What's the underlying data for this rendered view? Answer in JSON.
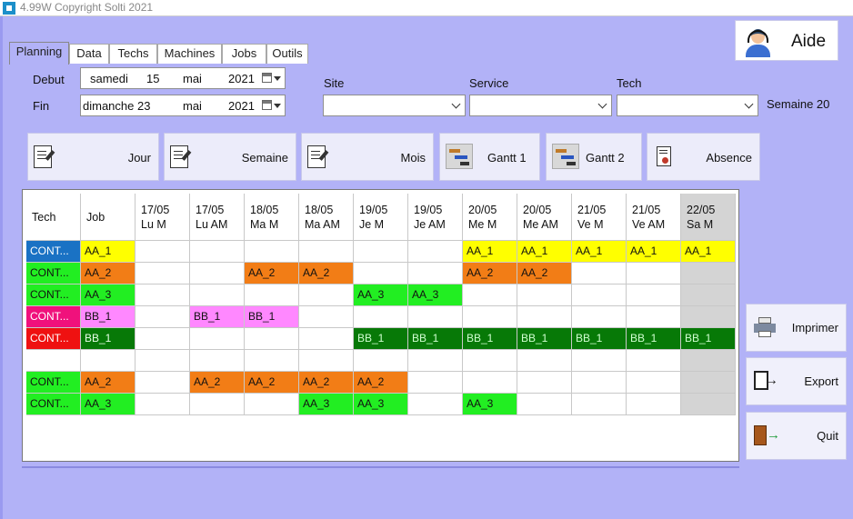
{
  "window": {
    "title": "4.99W Copyright Solti 2021"
  },
  "tabs": [
    "Planning",
    "Data",
    "Techs",
    "Machines",
    "Jobs",
    "Outils"
  ],
  "form": {
    "debut_label": "Debut",
    "fin_label": "Fin",
    "debut": {
      "weekday": "samedi",
      "day": "15",
      "month": "mai",
      "year": "2021"
    },
    "fin": {
      "weekday_day": "dimanche 23",
      "month": "mai",
      "year": "2021"
    },
    "site_label": "Site",
    "service_label": "Service",
    "tech_label": "Tech",
    "semaine": "Semaine 20"
  },
  "toolbar": {
    "jour": "Jour",
    "semaine": "Semaine",
    "mois": "Mois",
    "gantt1": "Gantt 1",
    "gantt2": "Gantt 2",
    "absence": "Absence"
  },
  "aide": "Aide",
  "side": {
    "imprimer": "Imprimer",
    "export": "Export",
    "quit": "Quit"
  },
  "colors": {
    "background": "#b2b2f7",
    "yellow": "#ffff00",
    "orange": "#f27d16",
    "green": "#22ee22",
    "pink": "#ff88ff",
    "darkgreen": "#077907",
    "blue": "#1a72c4",
    "magenta": "#f0117c",
    "red": "#ef1111",
    "weekend": "#d4d4d4"
  },
  "grid": {
    "header_tech": "Tech",
    "header_job": "Job",
    "columns": [
      {
        "date": "17/05",
        "slot": "Lu M"
      },
      {
        "date": "17/05",
        "slot": "Lu AM"
      },
      {
        "date": "18/05",
        "slot": "Ma M"
      },
      {
        "date": "18/05",
        "slot": "Ma AM"
      },
      {
        "date": "19/05",
        "slot": "Je M"
      },
      {
        "date": "19/05",
        "slot": "Je AM"
      },
      {
        "date": "20/05",
        "slot": "Me M"
      },
      {
        "date": "20/05",
        "slot": "Me AM"
      },
      {
        "date": "21/05",
        "slot": "Ve M"
      },
      {
        "date": "21/05",
        "slot": "Ve AM"
      },
      {
        "date": "22/05",
        "slot": "Sa M"
      }
    ],
    "rows": [
      {
        "tech": "CONT...",
        "tech_color": "blue",
        "job": "AA_1",
        "job_color": "yellow",
        "cells": [
          "",
          "",
          "",
          "",
          "",
          "",
          "AA_1",
          "AA_1",
          "AA_1",
          "AA_1",
          "AA_1"
        ],
        "cell_color": "yellow",
        "filled": [
          6,
          7,
          8,
          9,
          10
        ]
      },
      {
        "tech": "CONT...",
        "tech_color": "green",
        "job": "AA_2",
        "job_color": "orange",
        "cells": [
          "",
          "",
          "AA_2",
          "AA_2",
          "",
          "",
          "AA_2",
          "AA_2",
          "",
          "",
          ""
        ],
        "cell_color": "orange",
        "filled": [
          2,
          3,
          6,
          7
        ]
      },
      {
        "tech": "CONT...",
        "tech_color": "green",
        "job": "AA_3",
        "job_color": "green",
        "cells": [
          "",
          "",
          "",
          "",
          "AA_3",
          "AA_3",
          "",
          "",
          "",
          "",
          ""
        ],
        "cell_color": "green",
        "filled": [
          4,
          5
        ]
      },
      {
        "tech": "CONT...",
        "tech_color": "magenta",
        "job": "BB_1",
        "job_color": "pink",
        "cells": [
          "",
          "BB_1",
          "BB_1",
          "",
          "",
          "",
          "",
          "",
          "",
          "",
          ""
        ],
        "cell_color": "pink",
        "filled": [
          1,
          2
        ]
      },
      {
        "tech": "CONT...",
        "tech_color": "red",
        "job": "BB_1",
        "job_color": "darkgreen",
        "cells": [
          "",
          "",
          "",
          "",
          "BB_1",
          "BB_1",
          "BB_1",
          "BB_1",
          "BB_1",
          "BB_1",
          "BB_1"
        ],
        "cell_color": "darkgreen",
        "filled": [
          4,
          5,
          6,
          7,
          8,
          9,
          10
        ]
      },
      {
        "tech": "",
        "tech_color": "",
        "job": "",
        "job_color": "",
        "cells": [
          "",
          "",
          "",
          "",
          "",
          "",
          "",
          "",
          "",
          "",
          ""
        ],
        "cell_color": "",
        "filled": []
      },
      {
        "tech": "CONT...",
        "tech_color": "green",
        "job": "AA_2",
        "job_color": "orange",
        "cells": [
          "",
          "AA_2",
          "AA_2",
          "AA_2",
          "AA_2",
          "",
          "",
          "",
          "",
          "",
          ""
        ],
        "cell_color": "orange",
        "filled": [
          1,
          2,
          3,
          4
        ]
      },
      {
        "tech": "CONT...",
        "tech_color": "green",
        "job": "AA_3",
        "job_color": "green",
        "cells": [
          "",
          "",
          "",
          "AA_3",
          "AA_3",
          "",
          "AA_3",
          "",
          "",
          "",
          ""
        ],
        "cell_color": "green",
        "filled": [
          3,
          4,
          6
        ]
      }
    ]
  }
}
